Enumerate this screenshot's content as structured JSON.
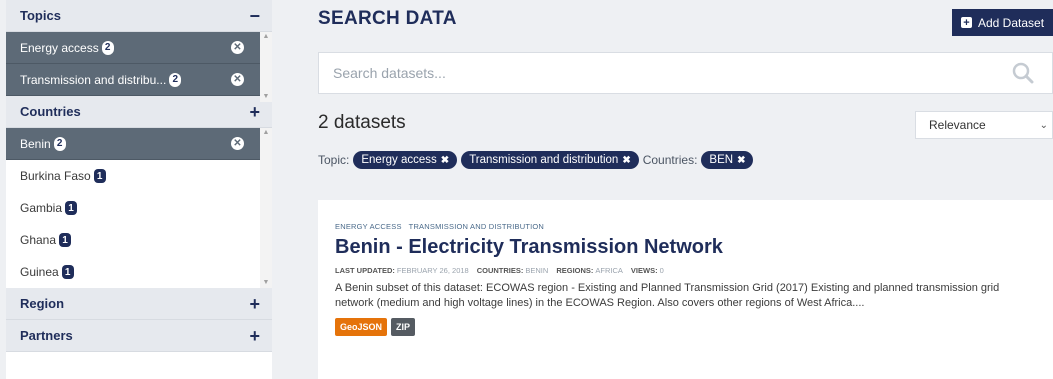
{
  "sidebar": {
    "topics": {
      "title": "Topics",
      "toggle": "−",
      "items": [
        {
          "label": "Energy access",
          "count": "2",
          "selected": true
        },
        {
          "label": "Transmission and distribu...",
          "count": "2",
          "selected": true
        }
      ]
    },
    "countries": {
      "title": "Countries",
      "toggle": "+",
      "items": [
        {
          "label": "Benin",
          "count": "2",
          "selected": true
        },
        {
          "label": "Burkina Faso",
          "count": "1",
          "selected": false
        },
        {
          "label": "Gambia",
          "count": "1",
          "selected": false
        },
        {
          "label": "Ghana",
          "count": "1",
          "selected": false
        },
        {
          "label": "Guinea",
          "count": "1",
          "selected": false
        }
      ]
    },
    "region": {
      "title": "Region",
      "toggle": "+"
    },
    "partners": {
      "title": "Partners",
      "toggle": "+"
    }
  },
  "header": {
    "title": "SEARCH DATA",
    "add_button": "Add Dataset"
  },
  "search": {
    "placeholder": "Search datasets...",
    "value": ""
  },
  "results": {
    "count_label": "2 datasets",
    "sort_selected": "Relevance"
  },
  "active_filters": {
    "topic_label": "Topic:",
    "topic_pills": [
      "Energy access",
      "Transmission and distribution"
    ],
    "countries_label": "Countries:",
    "country_pills": [
      "BEN"
    ]
  },
  "dataset": {
    "tags": [
      "ENERGY ACCESS",
      "TRANSMISSION AND DISTRIBUTION"
    ],
    "title": "Benin - Electricity Transmission Network",
    "meta": {
      "last_updated_label": "LAST UPDATED:",
      "last_updated": "FEBRUARY 26, 2018",
      "countries_label": "COUNTRIES:",
      "countries": "BENIN",
      "regions_label": "REGIONS:",
      "regions": "AFRICA",
      "views_label": "VIEWS:",
      "views": "0"
    },
    "description": "A Benin subset of this dataset: ECOWAS region - Existing and Planned Transmission Grid (2017) Existing and planned transmission grid network (medium and high voltage lines) in the ECOWAS Region. Also covers other regions of West Africa....",
    "formats": [
      "GeoJSON",
      "ZIP"
    ]
  },
  "colors": {
    "navy": "#1f2d5a",
    "selected_facet": "#5d6a77",
    "geojson_badge": "#e5730a",
    "zip_badge": "#555b62"
  }
}
